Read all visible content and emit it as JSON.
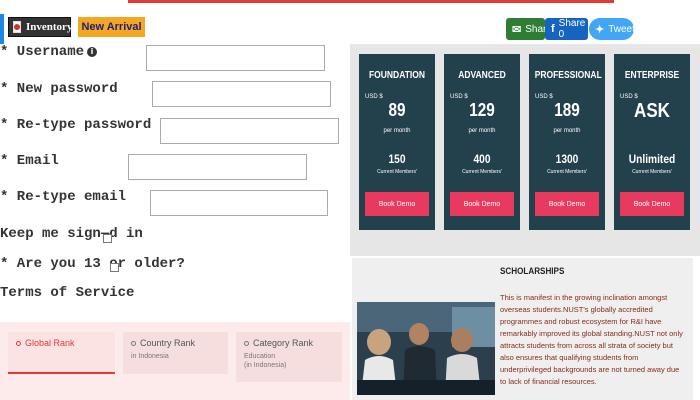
{
  "badges": {
    "inventory": "Inventory",
    "new_arrival": "New Arrival"
  },
  "form": {
    "username_label": "* Username",
    "new_password_label": "* New password",
    "retype_password_label": "* Re-type password",
    "email_label": "* Email",
    "retype_email_label": "* Re-type email",
    "keep_signed_label": "Keep me sign—d in",
    "age_label": "* Are you 13 or older?",
    "terms_label": "Terms of Service",
    "info_glyph": "i"
  },
  "ranks": [
    {
      "title": "Global Rank",
      "sub": ""
    },
    {
      "title": "Country Rank",
      "sub": "in Indonesia"
    },
    {
      "title": "Category Rank",
      "sub": "Education",
      "sub2": "(in Indonesia)"
    }
  ],
  "share": {
    "share_label": "Share",
    "facebook_label": "Share 0",
    "tweet_label": "Tweet"
  },
  "pricing": [
    {
      "name": "FOUNDATION",
      "currency": "USD $",
      "price": "89",
      "period": "per month",
      "members": "150",
      "members_label": "Current Members'",
      "cta": "Book Demo"
    },
    {
      "name": "ADVANCED",
      "currency": "USD $",
      "price": "129",
      "period": "per month",
      "members": "400",
      "members_label": "Current Members'",
      "cta": "Book Demo"
    },
    {
      "name": "PROFESSIONAL",
      "currency": "USD $",
      "price": "189",
      "period": "per month",
      "members": "1300",
      "members_label": "Current Members'",
      "cta": "Book Demo"
    },
    {
      "name": "ENTERPRISE",
      "currency": "USD $",
      "price": "ASK",
      "period": "",
      "members": "Unlimited",
      "members_label": "Current Members'",
      "cta": "Book Demo"
    }
  ],
  "scholarships": {
    "title": "SCHOLARSHIPS",
    "body": "This is manifest in the growing inclination amongst overseas students.NUST's globally accredited programmes and robust ecosystem for R&I have remarkably improved its global standing.NUST not only attracts students from across all strata of society but also ensures that qualifying students from underprivileged backgrounds are not turned away due to lack of financial resources."
  },
  "colors": {
    "accent_red": "#e53935",
    "card_bg": "#23414d",
    "cta": "#e83a5f",
    "badge_orange": "#f5a623"
  }
}
